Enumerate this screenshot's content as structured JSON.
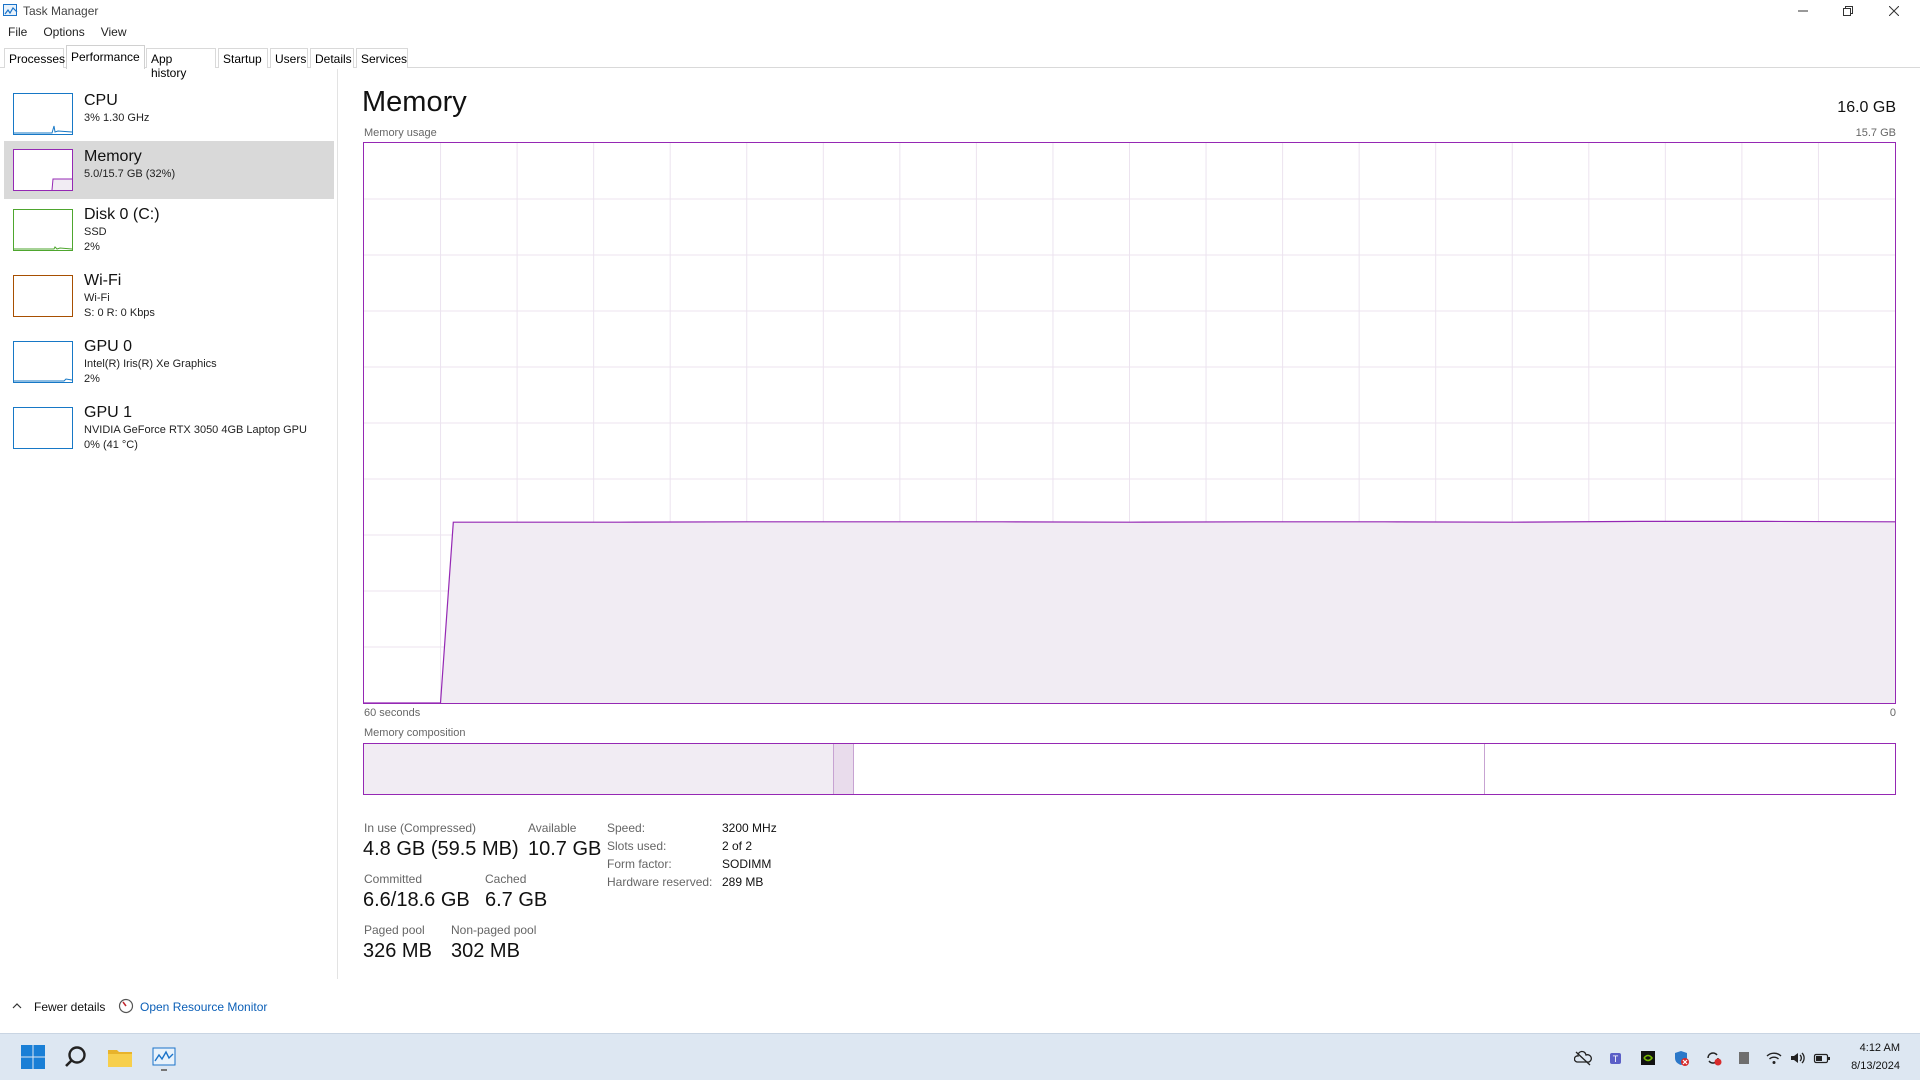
{
  "window": {
    "title": "Task Manager"
  },
  "menu": [
    "File",
    "Options",
    "View"
  ],
  "tabs": [
    "Processes",
    "Performance",
    "App history",
    "Startup",
    "Users",
    "Details",
    "Services"
  ],
  "active_tab": "Performance",
  "sidebar": [
    {
      "name": "CPU",
      "lines": [
        "3% 1.30 GHz"
      ],
      "color": "#1778c6"
    },
    {
      "name": "Memory",
      "lines": [
        "5.0/15.7 GB (32%)"
      ],
      "color": "#9528b4",
      "selected": true
    },
    {
      "name": "Disk 0 (C:)",
      "lines": [
        "SSD",
        "2%"
      ],
      "color": "#4ea62e"
    },
    {
      "name": "Wi-Fi",
      "lines": [
        "Wi-Fi",
        "S: 0 R: 0 Kbps"
      ],
      "color": "#a74f01"
    },
    {
      "name": "GPU 0",
      "lines": [
        "Intel(R) Iris(R) Xe Graphics",
        "2%"
      ],
      "color": "#1778c6"
    },
    {
      "name": "GPU 1",
      "lines": [
        "NVIDIA GeForce RTX 3050 4GB Laptop GPU",
        "0% (41 °C)"
      ],
      "color": "#1778c6"
    }
  ],
  "main": {
    "title": "Memory",
    "total": "16.0 GB",
    "usage_label": "Memory usage",
    "usage_max": "15.7 GB",
    "time_left": "60 seconds",
    "time_right": "0",
    "composition_label": "Memory composition"
  },
  "chart_data": {
    "type": "area",
    "title": "Memory usage",
    "xlabel": "60 seconds",
    "ylabel": "",
    "x": [
      60,
      57,
      56.5,
      55,
      50,
      45,
      40,
      35,
      30,
      25,
      20,
      15,
      10,
      5,
      0
    ],
    "series": [
      {
        "values": [
          0,
          0,
          5.07,
          5.07,
          5.07,
          5.08,
          5.08,
          5.08,
          5.07,
          5.08,
          5.08,
          5.07,
          5.09,
          5.09,
          5.08
        ]
      }
    ],
    "xlim": [
      60,
      0
    ],
    "ylim": [
      0,
      15.7
    ],
    "grid": true,
    "color": "#9528b4"
  },
  "composition": {
    "in_use_fraction": 0.307,
    "modified_fraction": 0.013,
    "standby_fraction": 0.412,
    "free_fraction": 0.268
  },
  "stats": {
    "in_use_label": "In use (Compressed)",
    "in_use_value": "4.8 GB (59.5 MB)",
    "available_label": "Available",
    "available_value": "10.7 GB",
    "committed_label": "Committed",
    "committed_value": "6.6/18.6 GB",
    "cached_label": "Cached",
    "cached_value": "6.7 GB",
    "paged_label": "Paged pool",
    "paged_value": "326 MB",
    "nonpaged_label": "Non-paged pool",
    "nonpaged_value": "302 MB"
  },
  "hardware": [
    {
      "key": "Speed:",
      "value": "3200 MHz"
    },
    {
      "key": "Slots used:",
      "value": "2 of 2"
    },
    {
      "key": "Form factor:",
      "value": "SODIMM"
    },
    {
      "key": "Hardware reserved:",
      "value": "289 MB"
    }
  ],
  "footer": {
    "fewer_details": "Fewer details",
    "resource_monitor": "Open Resource Monitor"
  },
  "taskbar": {
    "time": "4:12 AM",
    "date": "8/13/2024"
  }
}
